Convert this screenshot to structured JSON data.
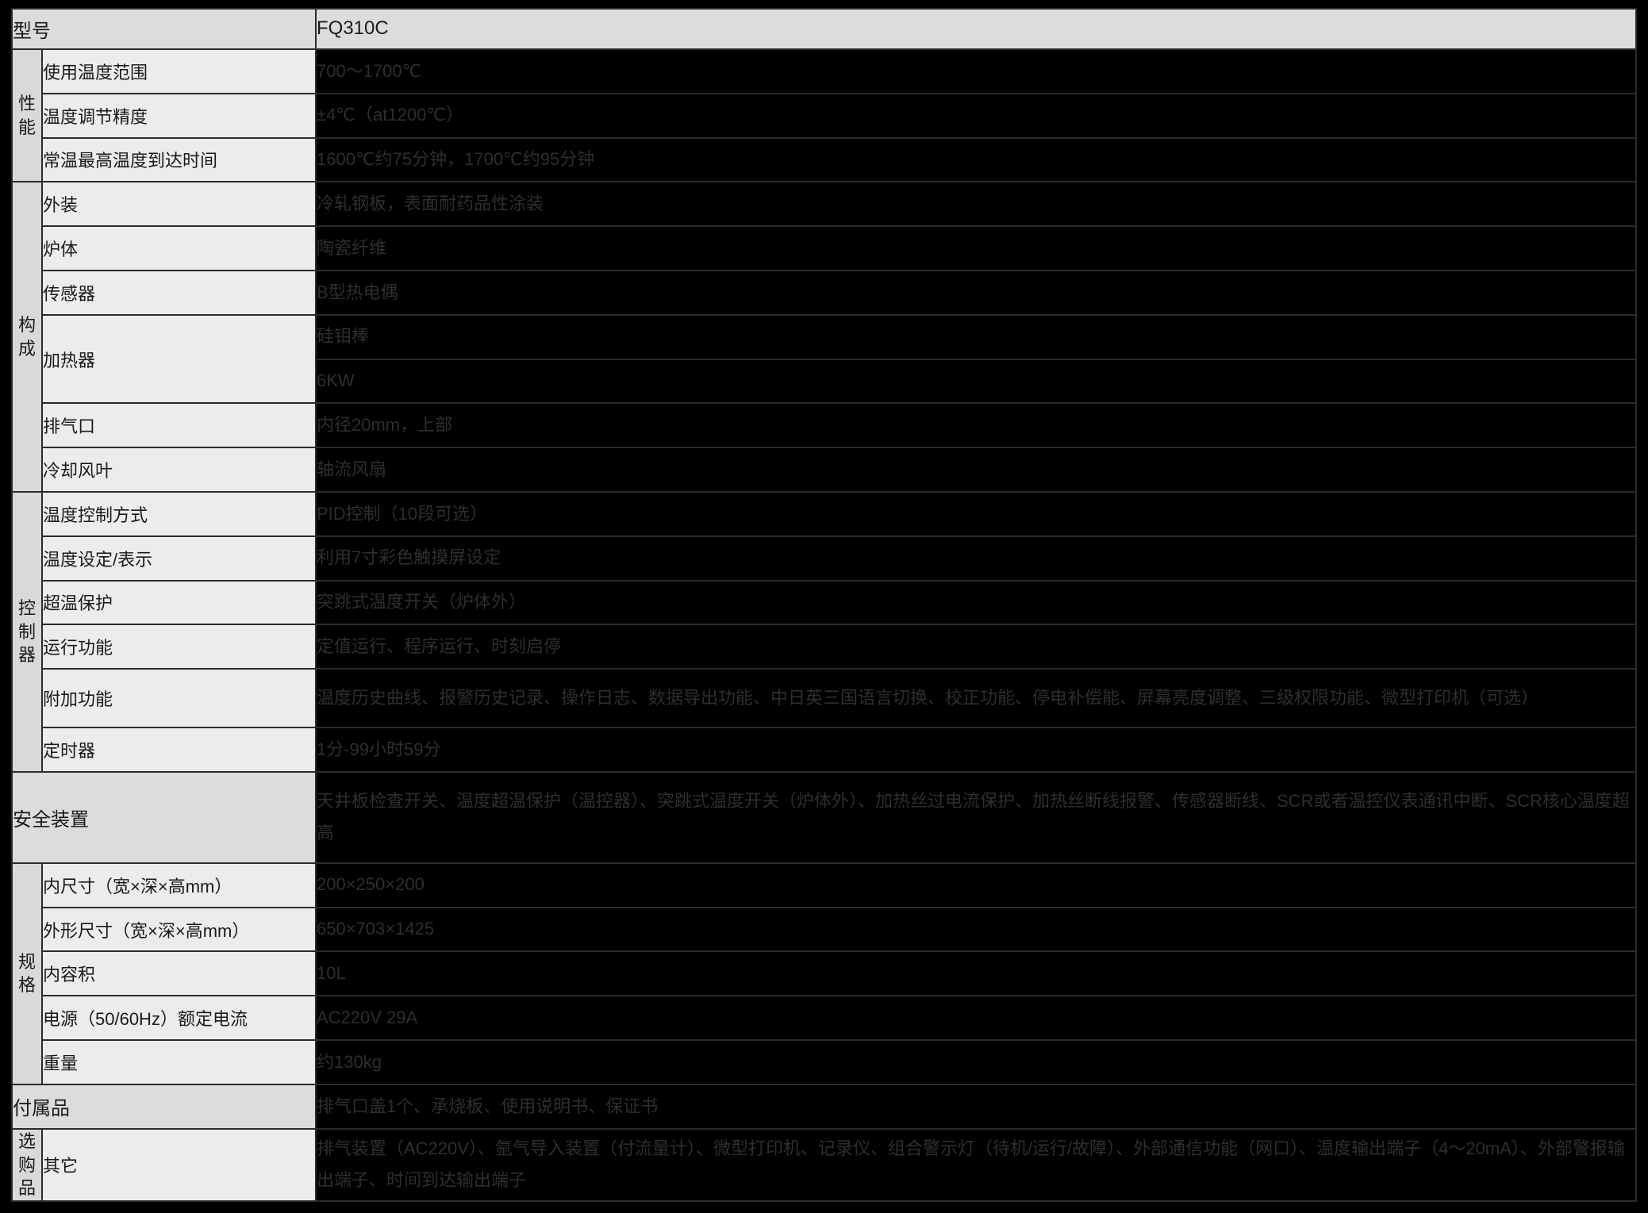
{
  "table": {
    "header": {
      "item_label": "型号",
      "value_label": "FQ310C"
    },
    "sections": [
      {
        "name": "性能",
        "rows": [
          {
            "item": "使用温度范围",
            "value": "700～1700℃"
          },
          {
            "item": "温度调节精度",
            "value": "±4℃（at1200℃）"
          },
          {
            "item": "常温最高温度到达时间",
            "value": "1600℃约75分钟，1700℃约95分钟"
          }
        ]
      },
      {
        "name": "构成",
        "rows": [
          {
            "item": "外装",
            "value": "冷轧钢板，表面耐药品性涂装"
          },
          {
            "item": "炉体",
            "value": "陶瓷纤维"
          },
          {
            "item": "传感器",
            "value": "B型热电偶"
          },
          {
            "item": "加热器",
            "value": "硅钼棒",
            "value2": "6KW"
          },
          {
            "item": "排气口",
            "value": "内径20mm，上部"
          },
          {
            "item": "冷却风叶",
            "value": "轴流风扇"
          }
        ]
      },
      {
        "name": "控制器",
        "rows": [
          {
            "item": "温度控制方式",
            "value": "PID控制（10段可选）"
          },
          {
            "item": "温度设定/表示",
            "value": "利用7寸彩色触摸屏设定"
          },
          {
            "item": "超温保护",
            "value": "突跳式温度开关（炉体外）"
          },
          {
            "item": "运行功能",
            "value": "定值运行、程序运行、时刻启停"
          },
          {
            "item": "附加功能",
            "value": "温度历史曲线、报警历史记录、操作日志、数据导出功能、中日英三国语言切换、校正功能、停电补偿能、屏幕亮度调整、三级权限功能、微型打印机（可选）"
          },
          {
            "item": "定时器",
            "value": "1分-99小时59分"
          }
        ]
      }
    ],
    "safety": {
      "item": "安全装置",
      "value": "天井板检查开关、温度超温保护（温控器）、突跳式温度开关（炉体外）、加热丝过电流保护、加热丝断线报警、传感器断线、SCR或者温控仪表通讯中断、SCR核心温度超高"
    },
    "spec_section": {
      "name": "规格",
      "rows": [
        {
          "item": "内尺寸（宽×深×高mm）",
          "value": "200×250×200"
        },
        {
          "item": "外形尺寸（宽×深×高mm）",
          "value": "650×703×1425"
        },
        {
          "item": "内容积",
          "value": "10L"
        },
        {
          "item": "电源（50/60Hz）额定电流",
          "value": "AC220V 29A"
        },
        {
          "item": "重量",
          "value": "约130kg"
        }
      ]
    },
    "accessories": {
      "item": "付属品",
      "value": "排气口盖1个、承烧板、使用说明书、保证书"
    },
    "options": {
      "name": "选购品",
      "item": "其它",
      "value": "排气装置（AC220V）、氩气导入装置（付流量计）、微型打印机、记录仪、组合警示灯（待机/运行/故障）、外部通信功能（网口）、温度输出端子（4～20mA）、外部警报输出端子、时间到达输出端子"
    }
  }
}
